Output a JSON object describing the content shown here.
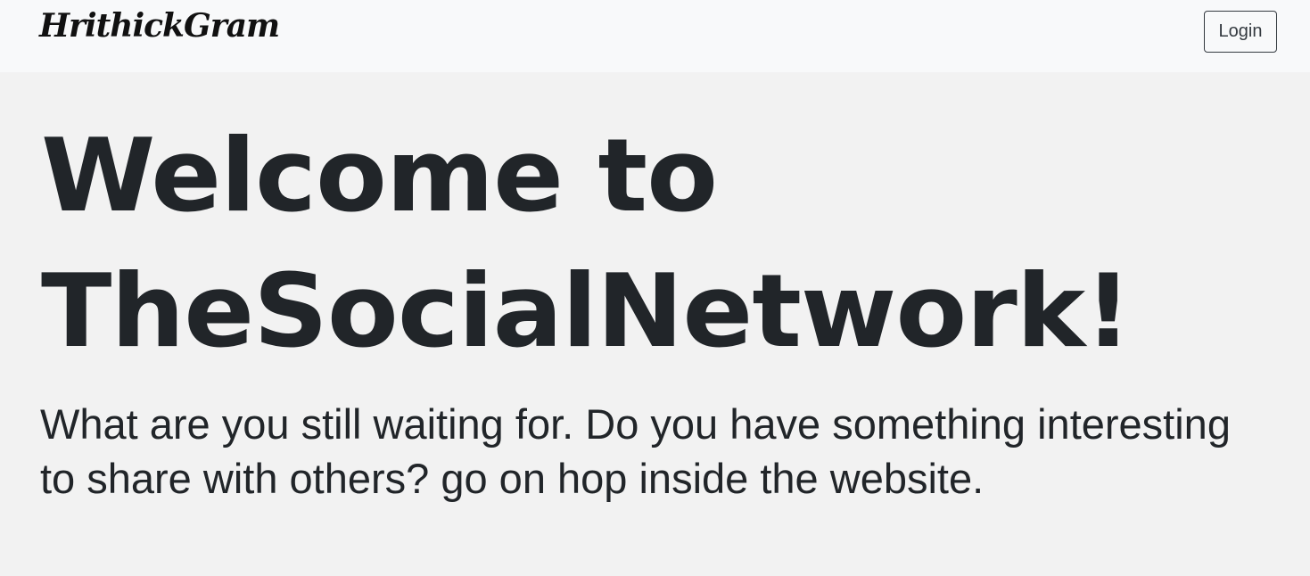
{
  "navbar": {
    "brand": "HrithickGram",
    "login_label": "Login"
  },
  "hero": {
    "title_line1": "Welcome to",
    "title_line2": "TheSocialNetwork!",
    "lead": "What are you still waiting for. Do you have something interesting to share with others? go on hop inside the website."
  },
  "colors": {
    "navbar_bg": "#f8f9fa",
    "page_bg": "#f2f2f2",
    "text": "#212529",
    "button_border": "#343a40"
  }
}
